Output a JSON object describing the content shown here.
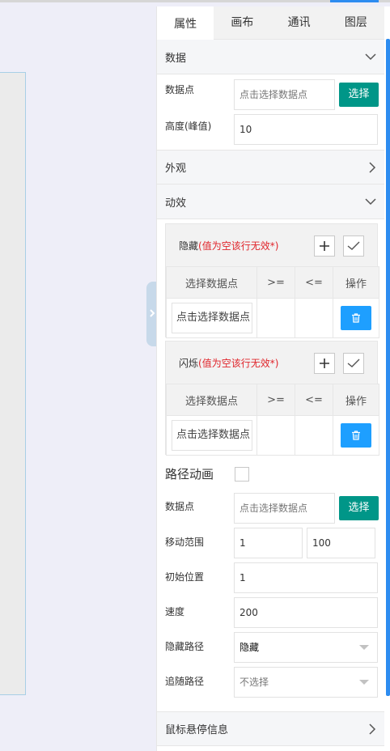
{
  "tabs": [
    "属性",
    "画布",
    "通讯",
    "图层"
  ],
  "sections": {
    "data": {
      "title": "数据",
      "datapoint_label": "数据点",
      "datapoint_placeholder": "点击选择数据点",
      "select_button": "选择",
      "height_label": "高度(峰值)",
      "height_value": "10"
    },
    "appearance": {
      "title": "外观"
    },
    "effects": {
      "title": "动效"
    },
    "hover": {
      "title": "鼠标悬停信息"
    }
  },
  "hide_box": {
    "title": "隐藏",
    "hint": "(值为空该行无效*)",
    "columns": [
      "选择数据点",
      ">=",
      "<=",
      "操作"
    ],
    "row_placeholder": "点击选择数据点"
  },
  "blink_box": {
    "title": "闪烁",
    "hint": "(值为空该行无效*)",
    "columns": [
      "选择数据点",
      ">=",
      "<=",
      "操作"
    ],
    "row_placeholder": "点击选择数据点"
  },
  "path_animation": {
    "title": "路径动画",
    "checked": false,
    "datapoint_label": "数据点",
    "datapoint_placeholder": "点击选择数据点",
    "select_button": "选择",
    "range_label": "移动范围",
    "range_min": "1",
    "range_max": "100",
    "start_label": "初始位置",
    "start_value": "1",
    "speed_label": "速度",
    "speed_value": "200",
    "hide_path_label": "隐藏路径",
    "hide_path_value": "隐藏",
    "follow_path_label": "追随路径",
    "follow_path_value": "不选择"
  },
  "colors": {
    "accent_green": "#009688",
    "accent_blue": "#1e9fff",
    "warning_red": "#e0242a",
    "scrollbar": "#2d8cf0"
  }
}
